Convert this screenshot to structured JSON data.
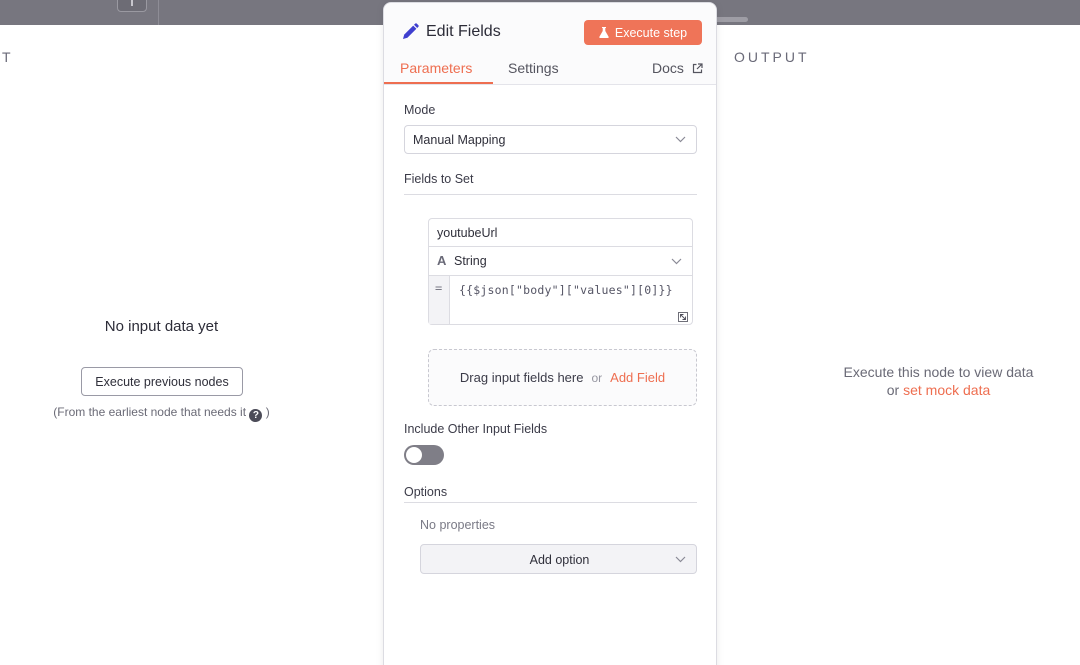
{
  "left_panel": {
    "title": "T",
    "no_input": "No input data yet",
    "execute_previous_label": "Execute previous nodes",
    "note_prefix": "(From the earliest node that needs it",
    "note_suffix": ")"
  },
  "node": {
    "title": "Edit Fields",
    "execute_step_label": "Execute step",
    "tabs": [
      {
        "label": "Parameters"
      },
      {
        "label": "Settings"
      },
      {
        "label": "Docs"
      }
    ],
    "mode_label": "Mode",
    "mode_value": "Manual Mapping",
    "fields_to_set_label": "Fields to Set",
    "field": {
      "name": "youtubeUrl",
      "type_icon": "A",
      "type": "String",
      "eq": "=",
      "expression": "{{$json[\"body\"][\"values\"][0]}}"
    },
    "drop_zone": {
      "text": "Drag input fields here",
      "or": "or",
      "add_field": "Add Field"
    },
    "include_other_label": "Include Other Input Fields",
    "include_other_enabled": false,
    "options_label": "Options",
    "no_properties": "No properties",
    "add_option_label": "Add option"
  },
  "right_panel": {
    "title": "OUTPUT",
    "msg_line1": "Execute this node to view data",
    "msg_or": "or",
    "set_mock_data": "set mock data"
  },
  "colors": {
    "accent": "#ee6e50",
    "execute_button": "#ef7458",
    "pencil": "#3f3fcf",
    "topbar": "#77767f"
  },
  "icons": [
    "pencil-icon",
    "flask-icon",
    "external-link-icon",
    "chevron-down-icon",
    "string-type-icon",
    "resize-icon",
    "help-icon"
  ]
}
